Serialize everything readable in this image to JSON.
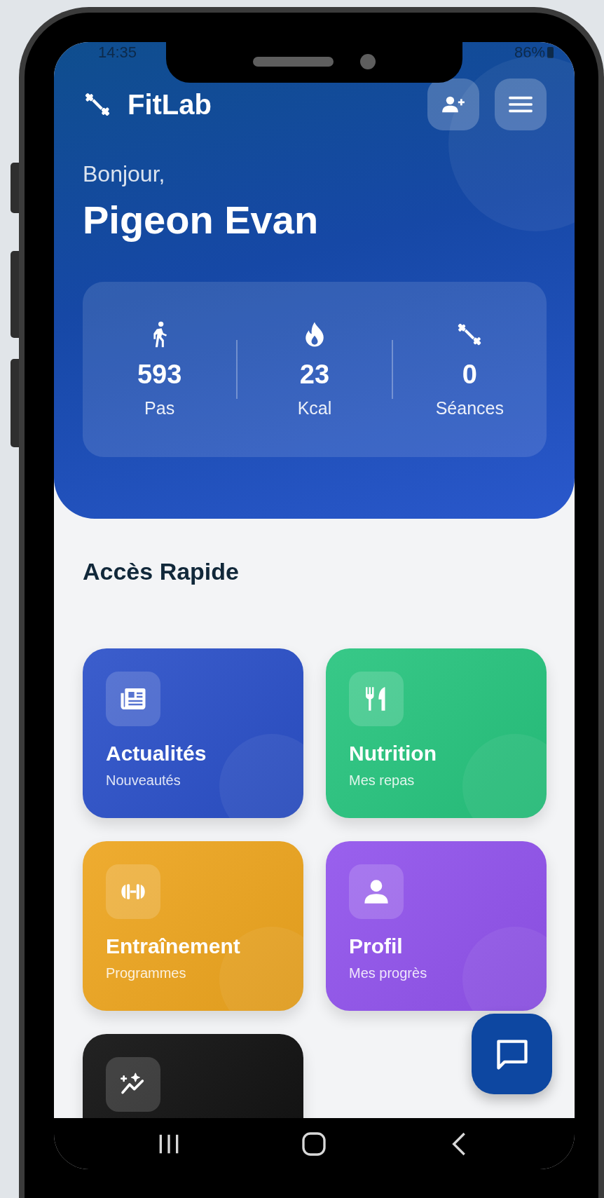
{
  "status_bar": {
    "time": "14:35",
    "battery": "86%"
  },
  "header": {
    "app_name": "FitLab",
    "greeting": "Bonjour,",
    "user_name": "Pigeon Evan"
  },
  "stats": [
    {
      "kind": "steps",
      "value": "593",
      "label": "Pas"
    },
    {
      "kind": "calories",
      "value": "23",
      "label": "Kcal"
    },
    {
      "kind": "sessions",
      "value": "0",
      "label": "Séances"
    }
  ],
  "quick_access": {
    "title": "Accès Rapide",
    "cards": [
      {
        "kind": "news",
        "title": "Actualités",
        "subtitle": "Nouveautés",
        "color": "#2b50c8"
      },
      {
        "kind": "food",
        "title": "Nutrition",
        "subtitle": "Mes repas",
        "color": "#27c47e"
      },
      {
        "kind": "workout",
        "title": "Entraînement",
        "subtitle": "Programmes",
        "color": "#eda51f"
      },
      {
        "kind": "profile",
        "title": "Profil",
        "subtitle": "Mes progrès",
        "color": "#9153ec"
      },
      {
        "kind": "stats",
        "color": "#101010"
      }
    ]
  }
}
